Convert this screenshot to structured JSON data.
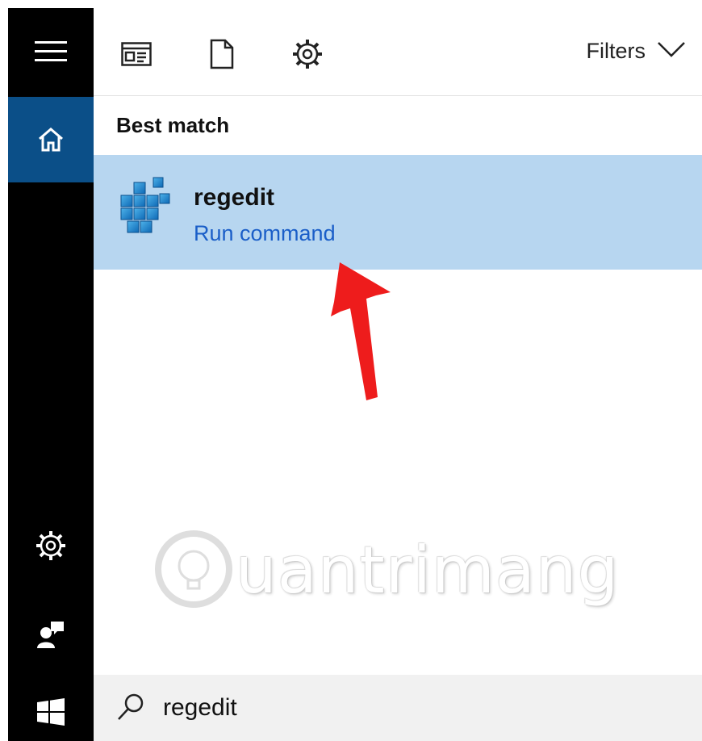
{
  "filters": {
    "label": "Filters"
  },
  "section": {
    "title": "Best match"
  },
  "result": {
    "title": "regedit",
    "subtitle": "Run command"
  },
  "watermark": {
    "text": "uantrimang"
  },
  "search": {
    "value": "regedit"
  },
  "icons": {
    "rail": [
      "hamburger-menu-icon",
      "home-icon",
      "settings-gear-icon",
      "user-feedback-icon",
      "windows-start-icon"
    ],
    "topbar": [
      "apps-icon",
      "documents-icon",
      "settings-gear-icon",
      "chevron-down-icon"
    ],
    "result": "registry-editor-icon",
    "search": "search-icon"
  },
  "colors": {
    "rail": "#000000",
    "rail_home_active": "#0b4f88",
    "result_highlight": "#b7d6f0",
    "subtitle_link": "#1a5ec8",
    "arrow": "#ee1c1c",
    "searchbar": "#f1f1f1"
  }
}
